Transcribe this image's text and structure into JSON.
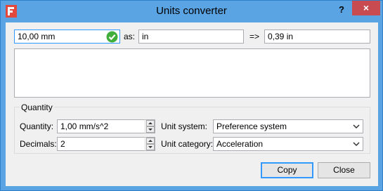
{
  "window": {
    "title": "Units converter",
    "help_label": "?",
    "close_label": "×"
  },
  "converter": {
    "input_value": "10,00 mm",
    "as_label": "as:",
    "target_unit": "in",
    "arrow_label": "=>",
    "result_value": "0,39 in"
  },
  "quantity_group": {
    "title": "Quantity",
    "quantity_label": "Quantity:",
    "quantity_value": "1,00 mm/s^2",
    "decimals_label": "Decimals:",
    "decimals_value": "2",
    "unit_system_label": "Unit system:",
    "unit_system_value": "Preference system",
    "unit_category_label": "Unit category:",
    "unit_category_value": "Acceleration"
  },
  "buttons": {
    "copy": "Copy",
    "close": "Close"
  },
  "colors": {
    "titlebar": "#5aa4e4",
    "close_button": "#c74b50",
    "valid_check": "#3fae3a",
    "app_icon": "#e2483b"
  }
}
